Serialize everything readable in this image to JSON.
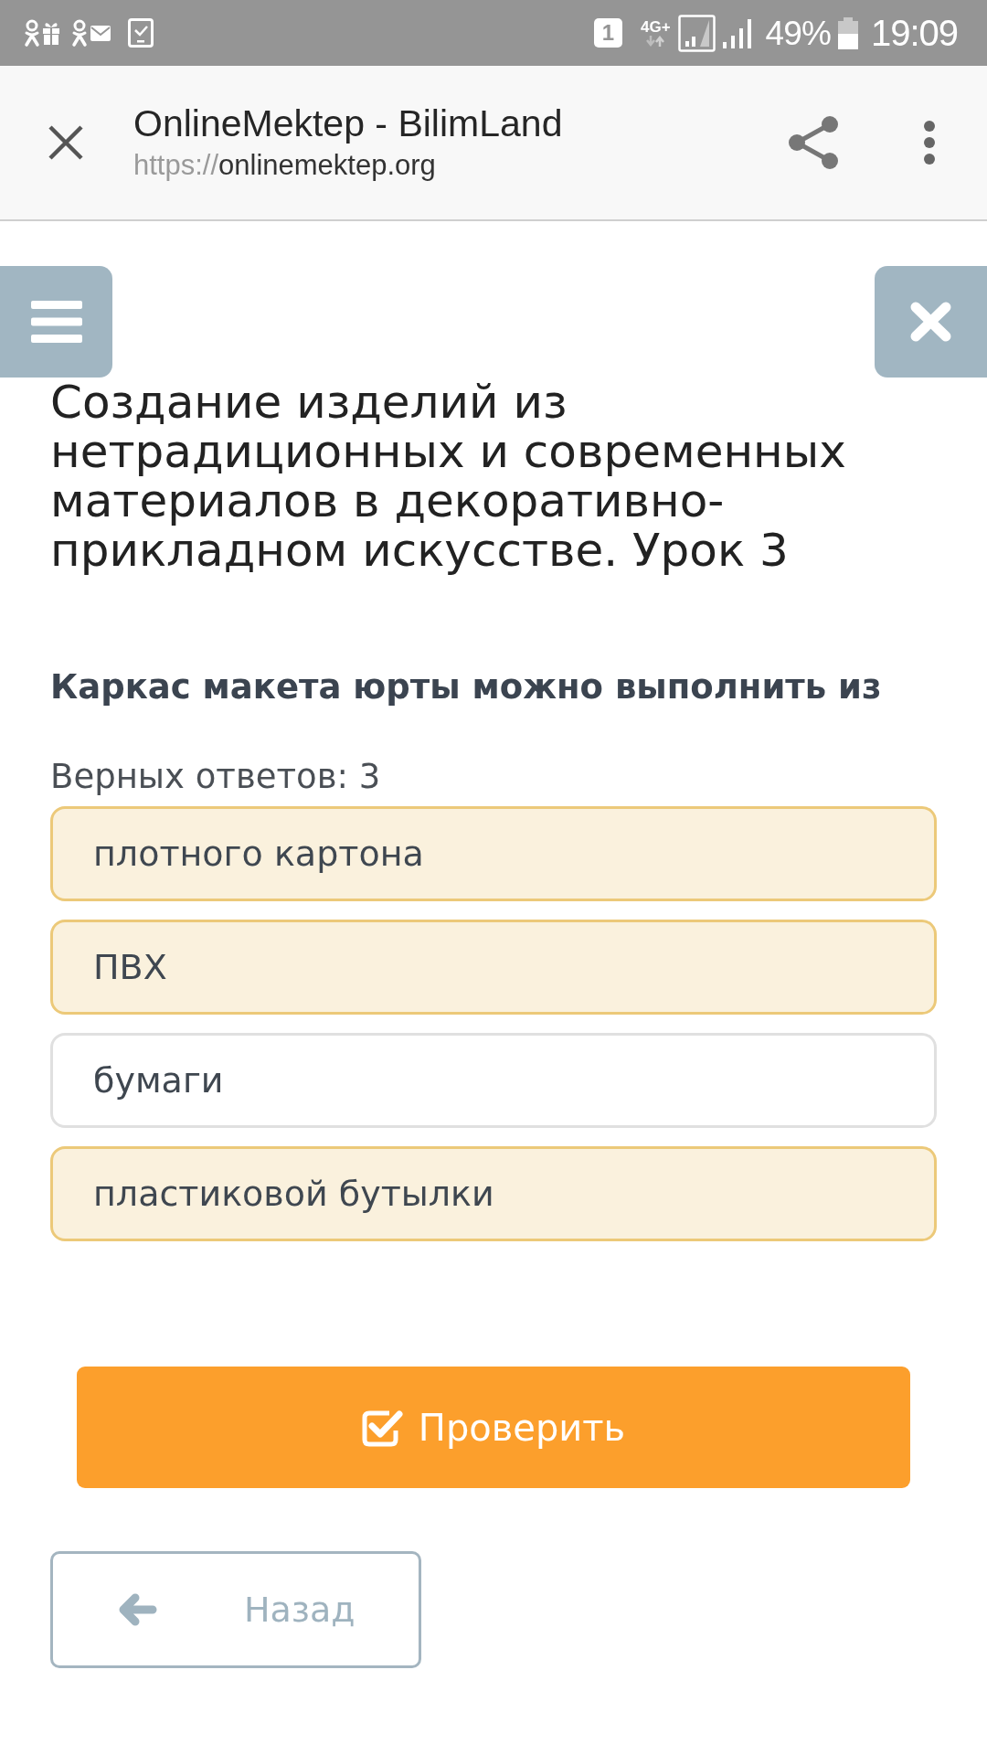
{
  "status_bar": {
    "sim_slot": "1",
    "network": "4G+",
    "battery": "49%",
    "time": "19:09"
  },
  "browser_bar": {
    "title": "OnlineMektep - BilimLand",
    "url": {
      "scheme": "https://",
      "host": "onlinemektep.org"
    }
  },
  "lesson": {
    "title": "Создание изделий из нетрадиционных и современных материалов в декоративно-прикладном искусстве. Урок 3",
    "question": "Каркас макета юрты можно выполнить из",
    "answers_note": "Верных ответов: 3",
    "options": [
      {
        "label": "плотного картона",
        "selected": true
      },
      {
        "label": "ПВХ",
        "selected": true
      },
      {
        "label": "бумаги",
        "selected": false
      },
      {
        "label": "пластиковой бутылки",
        "selected": true
      }
    ]
  },
  "check_button": {
    "label": "Проверить"
  },
  "back_button": {
    "label": "Назад"
  }
}
